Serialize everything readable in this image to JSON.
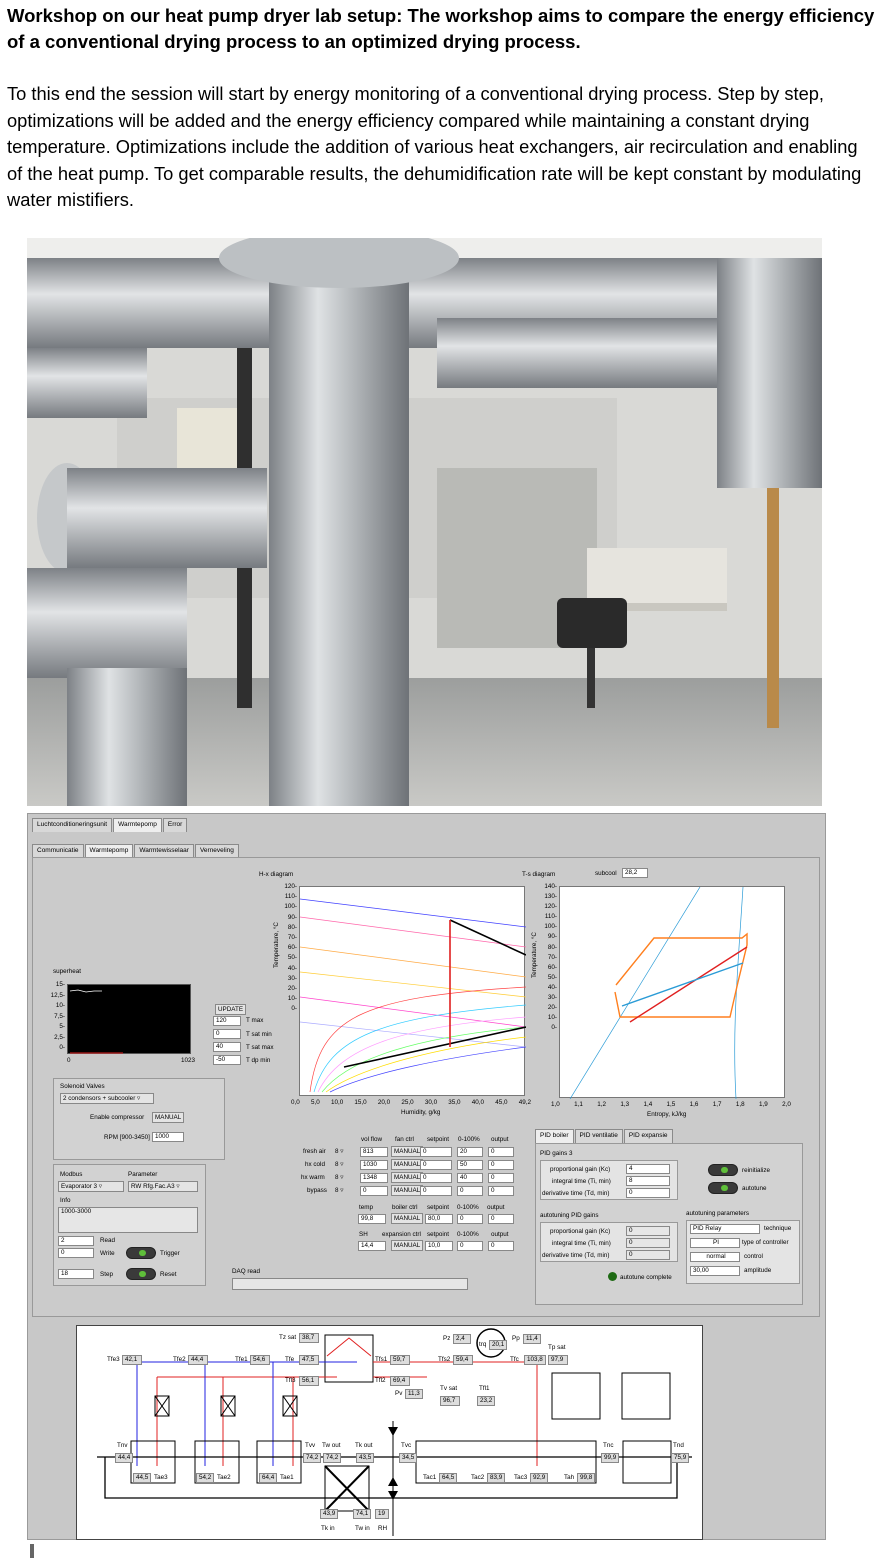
{
  "heading": "Workshop on our heat pump dryer lab setup: The workshop aims to compare the energy efficiency of a conventional drying process to an optimized drying process.",
  "paragraph": "To this end the session will start by energy monitoring of a conventional drying process. Step by step, optimizations will be added and the energy efficiency compared while maintaining a constant drying temperature. Optimizations include the addition of various heat exchangers, air recirculation and enabling of the heat pump. To get comparable results, the dehumidification rate will be kept constant by modulating water mistifiers.",
  "colors": {
    "pipe": "#b9bcbf",
    "lv_bg": "#c8c8c8",
    "plot_bg": "#000000",
    "ts_orange": "#ff7f1e",
    "ts_red": "#e02020",
    "ts_blue": "#2a9bd6"
  },
  "top_tabs": [
    "Luchtconditioneringsunit",
    "Warmtepomp",
    "Error"
  ],
  "sub_tabs": [
    "Communicatie",
    "Warmtepomp",
    "Warmtewisselaar",
    "Verneveling"
  ],
  "superheat": {
    "title": "superheat",
    "yticks": [
      "15-",
      "12,5-",
      "10-",
      "7,5-",
      "5-",
      "2,5-",
      "0-"
    ],
    "x_min": "0",
    "x_max": "1023"
  },
  "limits": {
    "update": "UPDATE",
    "tmax": "120",
    "tmax_l": "T max",
    "tsatmin": "0",
    "tsatmin_l": "T sat min",
    "tsatmax": "40",
    "tsatmax_l": "T sat max",
    "tdp": "-50",
    "tdp_l": "T dp min"
  },
  "hx": {
    "title": "H-x diagram",
    "ylabel": "Temperature, °C",
    "xlabel": "Humidity, g/kg",
    "yticks": [
      "120-",
      "110-",
      "100-",
      "90-",
      "80-",
      "70-",
      "60-",
      "50-",
      "40-",
      "30-",
      "20-",
      "10-",
      "0-"
    ],
    "xticks": [
      "0,0",
      "5,0",
      "10,0",
      "15,0",
      "20,0",
      "25,0",
      "30,0",
      "35,0",
      "40,0",
      "45,0",
      "49,2"
    ]
  },
  "ts": {
    "title": "T-s diagram",
    "subcool_l": "subcool",
    "subcool": "28,2",
    "ylabel": "Temperature, °C",
    "xlabel": "Entropy, kJ/kg",
    "yticks": [
      "140-",
      "130-",
      "120-",
      "110-",
      "100-",
      "90-",
      "80-",
      "70-",
      "60-",
      "50-",
      "40-",
      "30-",
      "20-",
      "10-",
      "0-"
    ],
    "xticks": [
      "1,0",
      "1,1",
      "1,2",
      "1,3",
      "1,4",
      "1,5",
      "1,6",
      "1,7",
      "1,8",
      "1,9",
      "2,0"
    ]
  },
  "solenoid": {
    "title": "Solenoid Valves",
    "select": "2 condensors + subcooler",
    "enable_l": "Enable compressor",
    "enable": "MANUAL",
    "rpm_l": "RPM [900-3450]",
    "rpm": "1000"
  },
  "modbus": {
    "modbus_l": "Modbus",
    "param_l": "Parameter",
    "device": "Evaporator 3",
    "param": "RW Rfg.Fac.A3",
    "info_l": "Info",
    "info": "1000-3000",
    "v1": "2",
    "read": "Read",
    "v2": "0",
    "write": "Write",
    "trigger": "Trigger",
    "v3": "18",
    "step": "Step",
    "reset": "Reset"
  },
  "daq": "DAQ read",
  "fans": {
    "h_vol": "vol flow",
    "h_ctrl": "fan ctrl",
    "h_set": "setpoint",
    "h_out": "0-100%",
    "h_output": "output",
    "rows": [
      {
        "label": "fresh air",
        "n": "8",
        "vol": "813",
        "mode": "MANUAL",
        "set": "0",
        "pct": "20",
        "out": "0"
      },
      {
        "label": "hx cold",
        "n": "8",
        "vol": "1030",
        "mode": "MANUAL",
        "set": "0",
        "pct": "50",
        "out": "0"
      },
      {
        "label": "hx warm",
        "n": "8",
        "vol": "1348",
        "mode": "MANUAL",
        "set": "0",
        "pct": "40",
        "out": "0"
      },
      {
        "label": "bypass",
        "n": "8",
        "vol": "0",
        "mode": "MANUAL",
        "set": "0",
        "pct": "0",
        "out": "0"
      }
    ],
    "temp_l": "temp",
    "boiler_l": "boiler ctrl",
    "bset_l": "setpoint",
    "bpct_l": "0-100%",
    "bout_l": "output",
    "temp": "99,8",
    "bmode": "MANUAL",
    "bset": "80,0",
    "bpct": "0",
    "bout": "0",
    "sh_l": "SH",
    "exp_l": "expansion ctrl",
    "eset_l": "setpoint",
    "epct_l": "0-100%",
    "eout_l": "output",
    "sh": "14,4",
    "emode": "MANUAL",
    "eset": "10,0",
    "epct": "0",
    "eout": "0"
  },
  "pid": {
    "tabs": [
      "PID boiler",
      "PID ventilatie",
      "PID expansie"
    ],
    "gains_l": "PID gains 3",
    "kc_l": "proportional gain (Kc)",
    "kc": "4",
    "ti_l": "integral time (Ti, min)",
    "ti": "8",
    "td_l": "derivative time (Td, min)",
    "td": "0",
    "reinit": "reinitialize",
    "autotune": "autotune",
    "auto_gains_l": "autotuning PID gains",
    "akc": "0",
    "ati": "0",
    "atd": "0",
    "auto_params_l": "autotuning parameters",
    "relay": "PID Relay",
    "technique": "technique",
    "pi": "PI",
    "type_l": "type of controller",
    "normal": "normal",
    "control": "control",
    "amp": "30,00",
    "amplitude": "amplitude",
    "complete": "autotune complete"
  },
  "diagram": {
    "tzsat_l": "Tz sat",
    "tzsat": "38,7",
    "tfe3_l": "Tfe3",
    "tfe3": "42,1",
    "tfe2_l": "Tfe2",
    "tfe2": "44,4",
    "tfe1_l": "Tfe1",
    "tfe1": "54,6",
    "tfe_l": "Tfe",
    "tfe": "47,5",
    "tfl3_l": "Tfl3",
    "tfl3": "56,1",
    "tfs1_l": "Tfs1",
    "tfs1": "59,7",
    "tfl2_l": "Tfl2",
    "tfl2": "69,4",
    "pz_l": "Pz",
    "pz": "2,4",
    "pv_l": "Pv",
    "pv": "11,3",
    "trq_l": "trq",
    "trq": "20,1",
    "pp_l": "Pp",
    "pp": "11,4",
    "tfs2_l": "Tfs2",
    "tfs2": "59,4",
    "tfc_l": "Tfc",
    "tfc": "103,8",
    "tpsat_l": "Tp sat",
    "tpsat": "97,9",
    "tvsat_l": "Tv sat",
    "tvsat": "96,7",
    "tfl1_l": "Tfl1",
    "tfl1": "23,2",
    "tnv_l": "Tnv",
    "tnv": "44,4",
    "tae3": "44,5",
    "tae3_l": "Tae3",
    "tae2": "54,2",
    "tae2_l": "Tae2",
    "tae1": "64,4",
    "tae1_l": "Tae1",
    "tvv_l": "Tvv",
    "twout_l": "Tw out",
    "tkout_l": "Tk out",
    "tvv": "74,2",
    "twout": "74,2",
    "tkout": "43,5",
    "tvc_l": "Tvc",
    "tvc": "34,5",
    "tac1_l": "Tac1",
    "tac1": "64,5",
    "tac2_l": "Tac2",
    "tac2": "83,9",
    "tac3_l": "Tac3",
    "tac3": "92,9",
    "tah_l": "Tah",
    "tah": "99,8",
    "tnc_l": "Tnc",
    "tnc": "99,9",
    "tnd_l": "Tnd",
    "tnd": "75,9",
    "tkin": "43,9",
    "twin": "74,1",
    "rh": "19",
    "tkin_l": "Tk in",
    "twin_l": "Tw in",
    "rh_l": "RH"
  }
}
